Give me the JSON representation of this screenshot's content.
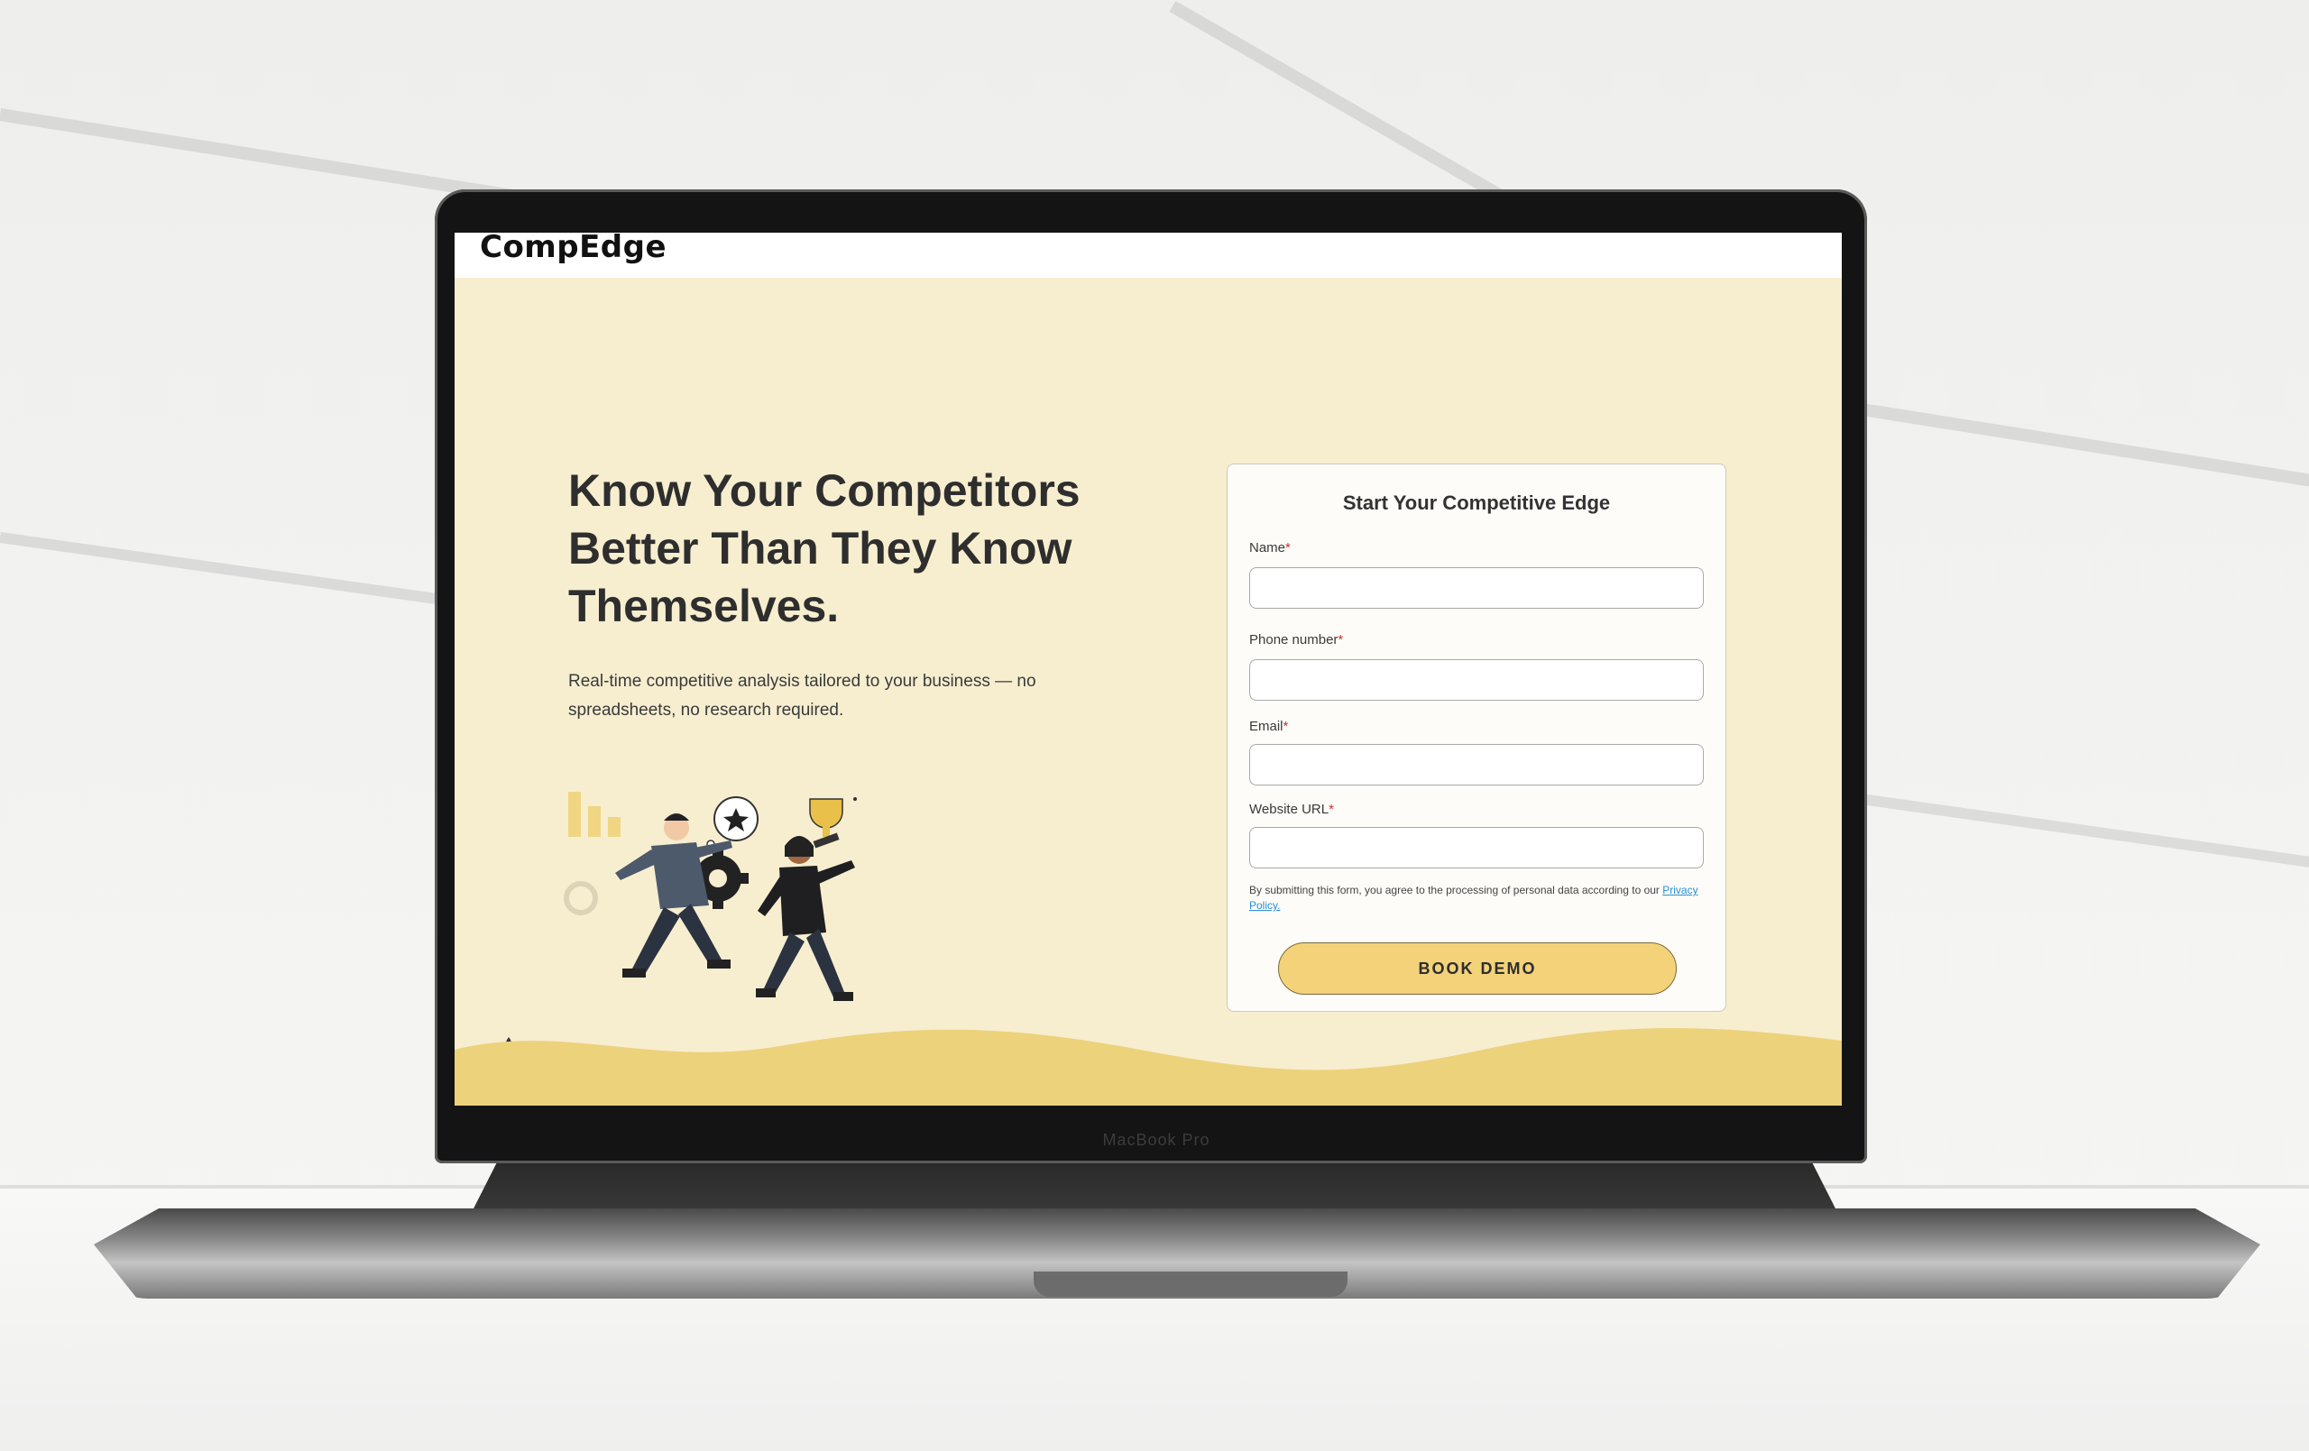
{
  "site": {
    "brand": "CompEdge"
  },
  "device": {
    "label": "MacBook Pro"
  },
  "hero": {
    "title": "Know Your Competitors Better Than They Know Themselves.",
    "subtitle": "Real-time competitive analysis tailored to your business — no spreadsheets, no research required."
  },
  "form": {
    "title": "Start Your Competitive Edge",
    "fields": [
      {
        "label": "Name",
        "required_mark": "*",
        "value": "",
        "placeholder": ""
      },
      {
        "label": "Phone number",
        "required_mark": "*",
        "value": "",
        "placeholder": ""
      },
      {
        "label": "Email",
        "required_mark": "*",
        "value": "",
        "placeholder": ""
      },
      {
        "label": "Website URL",
        "required_mark": "*",
        "value": "",
        "placeholder": ""
      }
    ],
    "consent_text": "By submitting this form, you agree to the processing of personal data according to our ",
    "privacy_link": "Privacy Policy.",
    "submit_label": "BOOK DEMO"
  },
  "colors": {
    "page_bg": "#f7eed0",
    "accent": "#f3d27a",
    "wave": "#edd27c",
    "required": "#d03030",
    "link": "#2a8fd6"
  },
  "icons": [
    "star-icon",
    "trophy-icon",
    "gear-icon",
    "bar-chart-icon"
  ]
}
